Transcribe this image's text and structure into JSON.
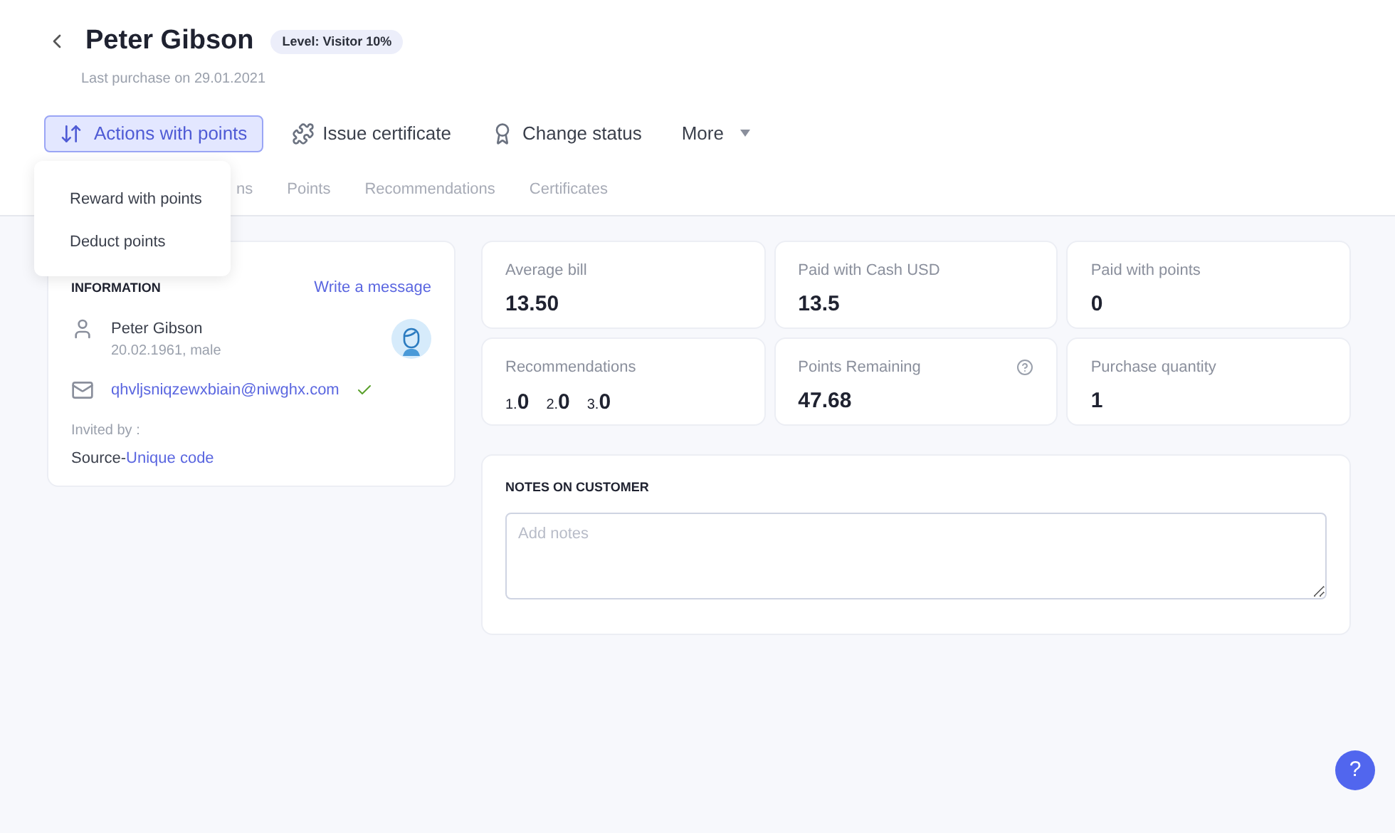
{
  "header": {
    "title": "Peter Gibson",
    "level_badge": "Level: Visitor 10%",
    "subtitle": "Last purchase on 29.01.2021"
  },
  "actions": [
    {
      "label": "Actions with points",
      "kind": "primary",
      "expanded": true
    },
    {
      "label": "Issue certificate",
      "kind": "certificate",
      "expanded": false
    },
    {
      "label": "Change status",
      "kind": "status",
      "expanded": false
    },
    {
      "label": "More",
      "kind": "dropdown",
      "expanded": false
    }
  ],
  "dropdown": {
    "items": [
      "Reward with points",
      "Deduct points"
    ]
  },
  "tabs": [
    "ns",
    "Points",
    "Recommendations",
    "Certificates"
  ],
  "info": {
    "heading": "INFORMATION",
    "link": "Write a message",
    "name": "Peter Gibson",
    "details": "20.02.1961, male",
    "email": "qhvljsniqzewxbiain@niwghx.com",
    "email_verified": true,
    "invited_label": "Invited by :",
    "source_prefix": "Source-",
    "source_link": "Unique code"
  },
  "stats": [
    {
      "label": "Average bill",
      "value": "13.50",
      "kind": "value",
      "help": false
    },
    {
      "label": "Paid with Cash USD",
      "value": "13.5",
      "kind": "value",
      "help": false
    },
    {
      "label": "Paid with points",
      "value": "0",
      "kind": "value",
      "help": false
    },
    {
      "label": "Recommendations",
      "kind": "levels",
      "help": false,
      "levels": [
        {
          "index": "1.",
          "value": "0"
        },
        {
          "index": "2.",
          "value": "0"
        },
        {
          "index": "3.",
          "value": "0"
        }
      ]
    },
    {
      "label": "Points Remaining",
      "value": "47.68",
      "kind": "value",
      "help": true
    },
    {
      "label": "Purchase quantity",
      "value": "1",
      "kind": "value",
      "help": false
    }
  ],
  "notes": {
    "heading": "NOTES ON CUSTOMER",
    "placeholder": "Add notes"
  },
  "help_button": "?"
}
